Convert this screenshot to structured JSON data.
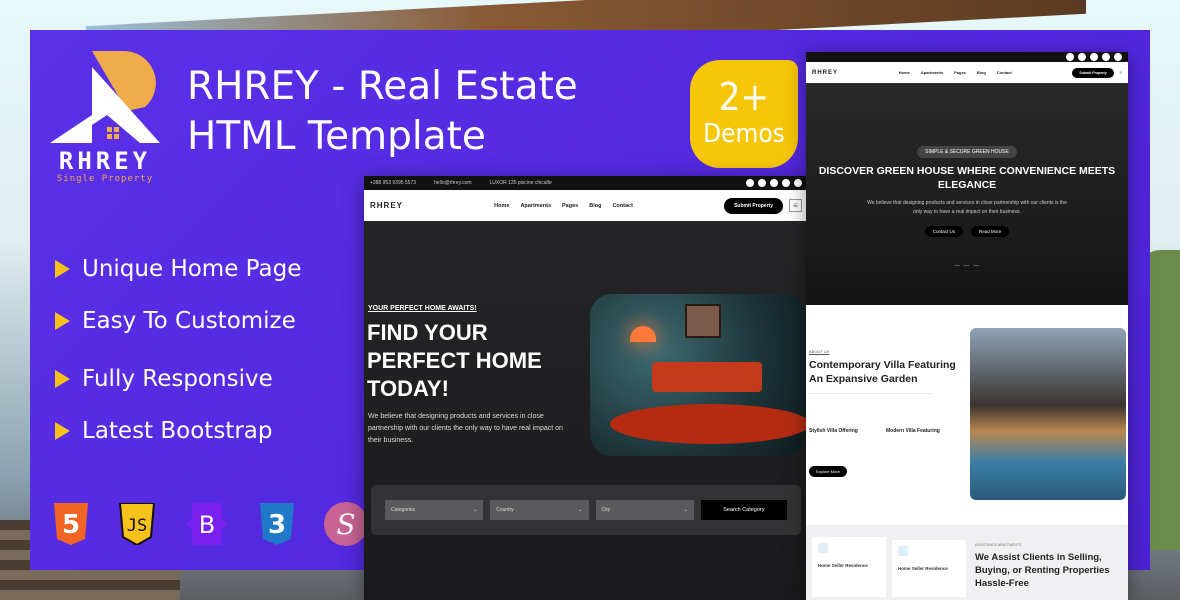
{
  "brand": {
    "name": "RHREY",
    "tagline": "Single Property"
  },
  "title": {
    "line1": "RHREY - Real Estate",
    "line2": "HTML Template"
  },
  "badge": {
    "count": "2+",
    "label": "Demos"
  },
  "features": [
    "Unique Home Page",
    "Easy To Customize",
    "Fully Responsive",
    "Latest Bootstrap"
  ],
  "techs": [
    {
      "icon": "html5-icon",
      "label": "5"
    },
    {
      "icon": "javascript-icon",
      "label": "JS"
    },
    {
      "icon": "bootstrap-icon",
      "label": "B"
    },
    {
      "icon": "css3-icon",
      "label": "3"
    },
    {
      "icon": "sass-icon",
      "label": "S"
    }
  ],
  "colors": {
    "panel": "#5128e0",
    "accent": "#f6c609",
    "logo_orange": "#f0ab4a"
  },
  "demo1": {
    "topbar": {
      "phone": "+388 953 9395 5573",
      "email": "hello@rhrey.com",
      "address": "LUXOR 135 piscine chicalfe"
    },
    "nav": {
      "logo": "RHREY",
      "links": [
        "Home",
        "Apartments",
        "Pages",
        "Blog",
        "Contact"
      ],
      "submit": "Submit Property"
    },
    "hero": {
      "eyebrow": "YOUR PERFECT HOME AWAITS!",
      "heading": "FIND YOUR PERFECT HOME TODAY!",
      "text": "We believe that designing products and services in close partnership with our clients the only way to have real impact on their business."
    },
    "search": {
      "categories": "Categories",
      "country": "Country",
      "city": "City",
      "button": "Search Category"
    }
  },
  "demo2": {
    "nav": {
      "logo": "RHREY",
      "links": [
        "Home",
        "Apartments",
        "Pages",
        "Blog",
        "Contact"
      ],
      "submit": "Submit Property"
    },
    "hero": {
      "pill": "SIMPLE & SECURE GREEN HOUSE",
      "heading": "DISCOVER GREEN HOUSE WHERE CONVENIENCE MEETS ELEGANCE",
      "text": "We believe that designing products and services in close partnership with our clients is the only way to have a real impact on their business.",
      "btn1": "Contact Us",
      "btn2": "Read More"
    },
    "about": {
      "eyebrow": "ABOUT US",
      "heading": "Contemporary Villa Featuring An Expansive Garden",
      "col1": "Stylish Villa Offering",
      "col2": "Modern Villa Featuring",
      "button": "Explore More"
    },
    "assist": {
      "card1": "Home Seller Residence",
      "card2": "Home Seller Residence",
      "eyebrow": "ASSISTANCE APARTMENTS",
      "heading": "We Assist Clients in Selling, Buying, or Renting Properties Hassle-Free"
    }
  }
}
